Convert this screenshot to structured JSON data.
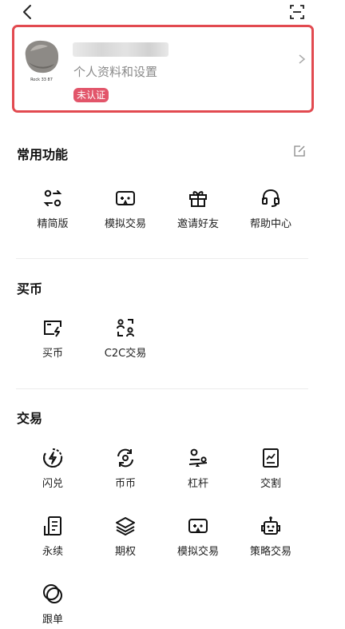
{
  "profile": {
    "subtitle": "个人资料和设置",
    "badge": "未认证",
    "avatar_caption": "Rock 33 87"
  },
  "sections": [
    {
      "title": "常用功能",
      "items": [
        {
          "label": "精简版",
          "icon": "switch-lite-icon"
        },
        {
          "label": "模拟交易",
          "icon": "game-controller-icon"
        },
        {
          "label": "邀请好友",
          "icon": "gift-icon"
        },
        {
          "label": "帮助中心",
          "icon": "headset-icon"
        }
      ]
    },
    {
      "title": "买币",
      "items": [
        {
          "label": "买币",
          "icon": "buy-coin-icon"
        },
        {
          "label": "C2C交易",
          "icon": "c2c-icon"
        }
      ]
    },
    {
      "title": "交易",
      "items": [
        {
          "label": "闪兑",
          "icon": "flash-swap-icon"
        },
        {
          "label": "币币",
          "icon": "coin-exchange-icon"
        },
        {
          "label": "杠杆",
          "icon": "leverage-icon"
        },
        {
          "label": "交割",
          "icon": "delivery-icon"
        },
        {
          "label": "永续",
          "icon": "perpetual-icon"
        },
        {
          "label": "期权",
          "icon": "options-layers-icon"
        },
        {
          "label": "模拟交易",
          "icon": "game-controller-icon"
        },
        {
          "label": "策略交易",
          "icon": "robot-icon"
        },
        {
          "label": "跟单",
          "icon": "copy-trade-icon"
        }
      ]
    }
  ]
}
